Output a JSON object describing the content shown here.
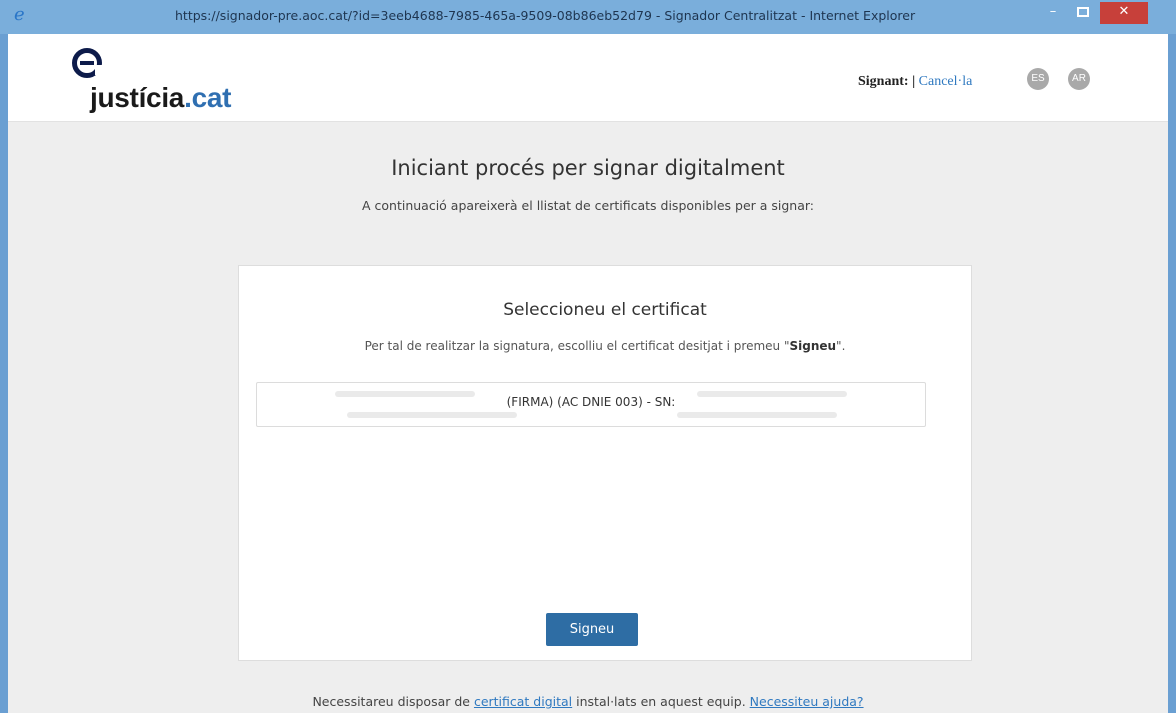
{
  "window": {
    "title": "https://signador-pre.aoc.cat/?id=3eeb4688-7985-465a-9509-08b86eb52d79 - Signador Centralitzat - Internet Explorer",
    "minimize_glyph": "–",
    "close_glyph": "✕"
  },
  "header": {
    "logo_text_main": "justícia",
    "logo_text_suffix": ".cat",
    "signer_label": "Signant: |",
    "cancel_link": "Cancel·la",
    "lang_es": "ES",
    "lang_ar": "AR"
  },
  "main": {
    "title": "Iniciant procés per signar digitalment",
    "subtitle": "A continuació apareixerà el llistat de certificats disponibles per a signar:"
  },
  "panel": {
    "title": "Seleccioneu el certificat",
    "desc_before": "Per tal de realitzar la signatura, escolliu el certificat desitjat i premeu \"",
    "desc_bold": "Signeu",
    "desc_after": "\".",
    "certificates": [
      {
        "label": "(FIRMA) (AC DNIE 003) - SN:"
      }
    ],
    "sign_button": "Signeu"
  },
  "footer": {
    "text_before": "Necessitareu disposar de ",
    "link_cert": "certificat digital",
    "text_middle": " instal·lats en aquest equip. ",
    "link_help": "Necessiteu ajuda?"
  },
  "colors": {
    "accent": "#2e6da4",
    "link": "#2f79c0",
    "logo_dark": "#0d1b4a",
    "logo_blue": "#2f6fb1",
    "window_frame": "#6a9fd2",
    "close_button": "#c7403a"
  }
}
